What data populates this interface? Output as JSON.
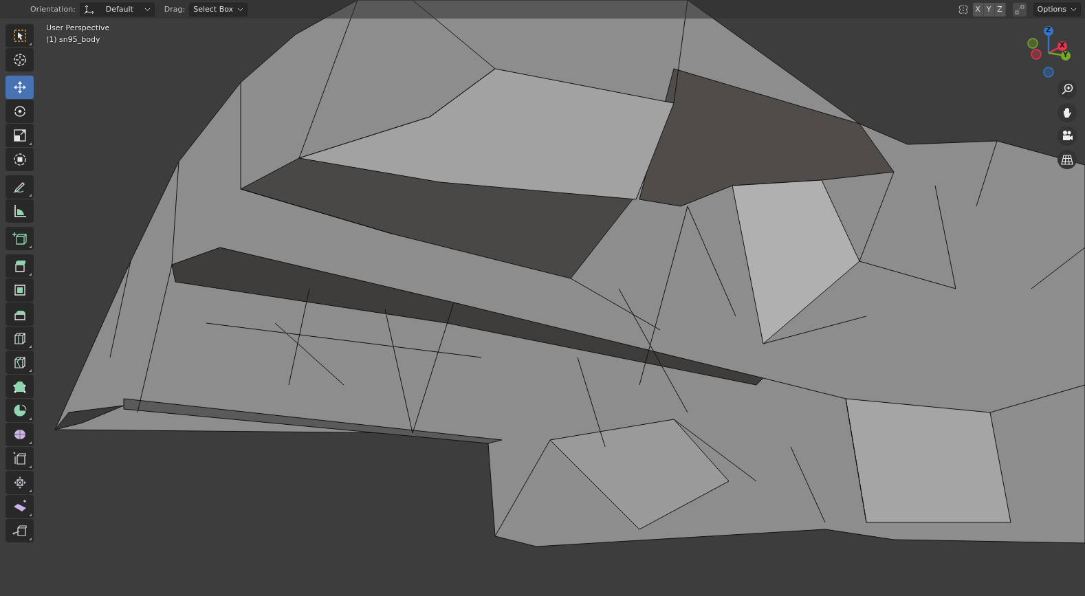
{
  "header": {
    "orientation_label": "Orientation:",
    "orientation_value": "Default",
    "drag_label": "Drag:",
    "drag_value": "Select Box",
    "axes": [
      {
        "label": "X",
        "selected": false
      },
      {
        "label": "Y",
        "selected": false
      },
      {
        "label": "Z",
        "selected": false
      }
    ],
    "options": "Options"
  },
  "overlay": {
    "view_name": "User Perspective",
    "object_name": "(1) sn95_body"
  },
  "toolbar": [
    [
      {
        "kind": "select",
        "selected": false,
        "submenu": true
      },
      {
        "kind": "cursor",
        "selected": false,
        "submenu": false
      }
    ],
    [
      {
        "kind": "move",
        "selected": true,
        "submenu": false
      },
      {
        "kind": "rotate",
        "selected": false,
        "submenu": false
      },
      {
        "kind": "scale",
        "selected": false,
        "submenu": true
      },
      {
        "kind": "transform",
        "selected": false,
        "submenu": false
      }
    ],
    [
      {
        "kind": "annotate",
        "selected": false,
        "submenu": true
      },
      {
        "kind": "measure",
        "selected": false,
        "submenu": false
      }
    ],
    [
      {
        "kind": "add_cube",
        "selected": false,
        "submenu": true
      }
    ],
    [
      {
        "kind": "extrude",
        "selected": false,
        "submenu": true
      },
      {
        "kind": "inset",
        "selected": false,
        "submenu": false
      },
      {
        "kind": "bevel",
        "selected": false,
        "submenu": false
      },
      {
        "kind": "loopcut",
        "selected": false,
        "submenu": true
      },
      {
        "kind": "knife",
        "selected": false,
        "submenu": true
      },
      {
        "kind": "polybuild",
        "selected": false,
        "submenu": false
      },
      {
        "kind": "spin",
        "selected": false,
        "submenu": true
      },
      {
        "kind": "smooth",
        "selected": false,
        "submenu": true
      },
      {
        "kind": "edge_slide",
        "selected": false,
        "submenu": true
      },
      {
        "kind": "shrink",
        "selected": false,
        "submenu": true
      },
      {
        "kind": "shear",
        "selected": false,
        "submenu": true
      },
      {
        "kind": "rip",
        "selected": false,
        "submenu": true
      }
    ]
  ],
  "gizmo": {
    "axes": [
      {
        "label": "Z",
        "color": "#2f77d0"
      },
      {
        "label": "X",
        "color": "#e8334d"
      },
      {
        "label": "Y",
        "color": "#78a926"
      }
    ]
  }
}
